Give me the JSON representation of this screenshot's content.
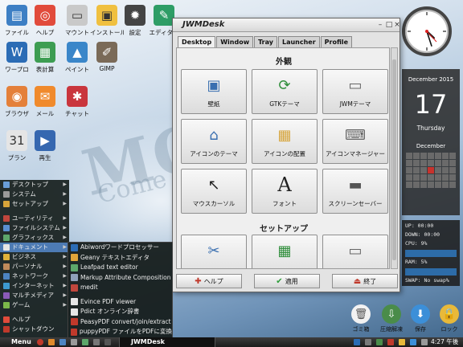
{
  "desktop": {
    "icons": [
      {
        "label": "ファイル",
        "icon": "file-manager-icon",
        "color": "#3d7fc4"
      },
      {
        "label": "ヘルプ",
        "icon": "lifebuoy-icon",
        "color": "#e14b3b"
      },
      {
        "label": "マウント",
        "icon": "drive-icon",
        "color": "#c9c9c9"
      },
      {
        "label": "インストール",
        "icon": "install-icon",
        "color": "#f0c040"
      },
      {
        "label": "設定",
        "icon": "gear-icon",
        "color": "#444444"
      },
      {
        "label": "エディター",
        "icon": "editor-icon",
        "color": "#2e9d66"
      },
      {
        "label": "ワープロ",
        "icon": "word-processor-icon",
        "color": "#2b6cb5"
      },
      {
        "label": "表計算",
        "icon": "spreadsheet-icon",
        "color": "#3d9d52"
      },
      {
        "label": "ペイント",
        "icon": "paint-icon",
        "color": "#3a86c9"
      },
      {
        "label": "GIMP",
        "icon": "gimp-icon",
        "color": "#7a6a58"
      },
      {
        "label": "ブラウザ",
        "icon": "browser-icon",
        "color": "#e4803a"
      },
      {
        "label": "メール",
        "icon": "mail-icon",
        "color": "#f08a2c"
      },
      {
        "label": "チャット",
        "icon": "chat-icon",
        "color": "#c9353d"
      },
      {
        "label": "プラン",
        "icon": "calendar-icon",
        "color": "#e5e5e5"
      },
      {
        "label": "再生",
        "icon": "media-player-icon",
        "color": "#3567b0"
      }
    ],
    "wallpaper_text": {
      "big": "MONEY",
      "tagline": "Come Le"
    }
  },
  "widgets": {
    "calendar": {
      "month_year": "December 2015",
      "day": "17",
      "weekday": "Thursday",
      "mini_month": "December",
      "today_index": 17
    },
    "sysmon": {
      "up": "UP:",
      "up_value": "00:00",
      "down": "DOWN:",
      "down_value": "00:00",
      "cpu": "CPU: 9%",
      "ram": "RAM: 5%",
      "swap": "SWAP: No swap%"
    },
    "clock": {
      "hour": 4,
      "minute": 27
    }
  },
  "dock": [
    {
      "label": "ゴミ箱",
      "icon": "trash-icon",
      "color": "#f2f2f2"
    },
    {
      "label": "圧縮解凍",
      "icon": "archive-icon",
      "color": "#4a8c4a"
    },
    {
      "label": "保存",
      "icon": "save-download-icon",
      "color": "#3c8fd8"
    },
    {
      "label": "ロック",
      "icon": "lock-icon",
      "color": "#e8b93a"
    }
  ],
  "window": {
    "title": "JWMDesk",
    "tabs": [
      "Desktop",
      "Window",
      "Tray",
      "Launcher",
      "Profile"
    ],
    "active_tab": "Desktop",
    "section_appearance": "外観",
    "section_setup": "セットアップ",
    "buttons": [
      {
        "label": "壁紙",
        "icon": "wallpaper-icon"
      },
      {
        "label": "GTKテーマ",
        "icon": "gtk-theme-icon"
      },
      {
        "label": "JWMテーマ",
        "icon": "jwm-theme-icon"
      },
      {
        "label": "アイコンのテーマ",
        "icon": "icon-theme-icon"
      },
      {
        "label": "アイコンの配置",
        "icon": "icon-arrange-icon"
      },
      {
        "label": "アイコンマネージャー",
        "icon": "icon-manager-icon"
      },
      {
        "label": "マウスカーソル",
        "icon": "cursor-icon"
      },
      {
        "label": "フォント",
        "icon": "font-icon"
      },
      {
        "label": "スクリーンセーバー",
        "icon": "screensaver-icon"
      },
      {
        "label": "",
        "icon": "tools-icon"
      },
      {
        "label": "",
        "icon": "hardware-icon"
      },
      {
        "label": "",
        "icon": "windows-icon"
      }
    ],
    "footer": {
      "help": "ヘルプ",
      "apply": "適用",
      "quit": "終了"
    }
  },
  "start_menu": {
    "items": [
      {
        "label": "デスクトップ",
        "color": "#6a9ed8",
        "submenu": true
      },
      {
        "label": "システム",
        "color": "#9a9a9a",
        "submenu": true
      },
      {
        "label": "セットアップ",
        "color": "#d7a43a",
        "submenu": true
      },
      {
        "label": "ユーティリティ",
        "color": "#c0463d",
        "submenu": true
      },
      {
        "label": "ファイルシステム",
        "color": "#5b8fd0",
        "submenu": true
      },
      {
        "label": "グラフィックス",
        "color": "#5da66a",
        "submenu": true
      },
      {
        "label": "ドキュメント",
        "color": "#e6e6e6",
        "submenu": true,
        "selected": true
      },
      {
        "label": "ビジネス",
        "color": "#e0b23a",
        "submenu": true
      },
      {
        "label": "パーソナル",
        "color": "#c08a5a",
        "submenu": true
      },
      {
        "label": "ネットワーク",
        "color": "#4c84c2",
        "submenu": true
      },
      {
        "label": "インターネット",
        "color": "#3d9ad0",
        "submenu": true
      },
      {
        "label": "マルチメディア",
        "color": "#8a5ab8",
        "submenu": true
      },
      {
        "label": "ゲーム",
        "color": "#7bb84a",
        "submenu": true
      },
      {
        "label": "ヘルプ",
        "color": "#e14b3b",
        "submenu": false
      },
      {
        "label": "シャットダウン",
        "color": "#c0392b",
        "submenu": false
      }
    ]
  },
  "sub_menu": {
    "items": [
      {
        "label": "Abiwordワードプロセッサー",
        "color": "#2b6cb5"
      },
      {
        "label": "Geany テキストエディタ",
        "color": "#e0a53a"
      },
      {
        "label": "Leafpad text editor",
        "color": "#5da66a"
      },
      {
        "label": "Markup Attribute Composition",
        "color": "#8fa0b8"
      },
      {
        "label": "medit",
        "color": "#c0463d"
      },
      {
        "label": "Evince PDF viewer",
        "color": "#e6e6e6"
      },
      {
        "label": "Pdict オンライン辞書",
        "color": "#e6e6e6"
      },
      {
        "label": "PeasyPDF convert/join/extract",
        "color": "#c0392b"
      },
      {
        "label": "puppyPDF ファイルをPDFに変換",
        "color": "#c0392b"
      }
    ]
  },
  "taskbar": {
    "menu_label": "Menu",
    "task_label": "JWMDesk",
    "clock": "4:27 午後"
  }
}
